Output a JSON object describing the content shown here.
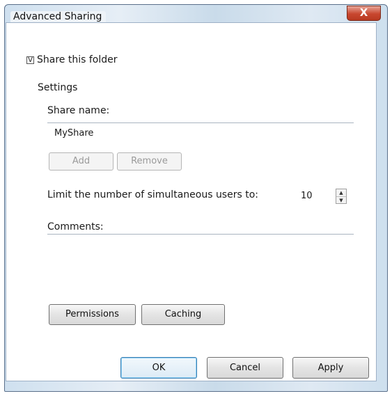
{
  "window": {
    "title": "Advanced Sharing",
    "close_glyph": "X"
  },
  "share": {
    "checkbox_label": "Share this folder",
    "checked": true,
    "check_glyph": "V"
  },
  "settings": {
    "group_label": "Settings",
    "share_name_label": "Share name:",
    "share_name_value": "MyShare",
    "add_label": "Add",
    "remove_label": "Remove",
    "limit_label": "Limit the number of simultaneous users to:",
    "limit_value": "10",
    "comments_label": "Comments:"
  },
  "buttons": {
    "permissions_label": "Permissions",
    "caching_label": "Caching",
    "ok_label": "OK",
    "cancel_label": "Cancel",
    "apply_label": "Apply"
  },
  "icons": {
    "spin_up": "chevron-up-icon",
    "spin_down": "chevron-down-icon",
    "close": "close-icon"
  }
}
